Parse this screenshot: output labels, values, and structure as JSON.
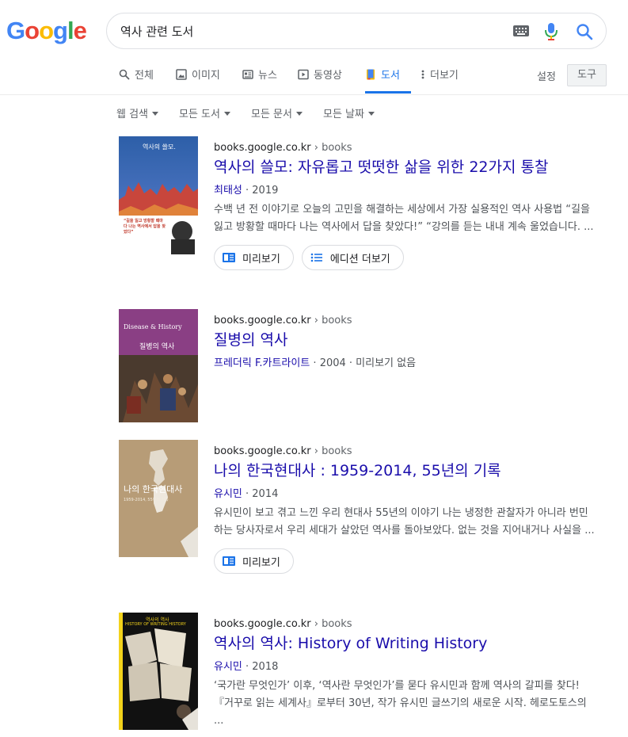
{
  "logo": {
    "letters": [
      "G",
      "o",
      "o",
      "g",
      "l",
      "e"
    ],
    "colors": [
      "#4285f4",
      "#ea4335",
      "#fbbc05",
      "#4285f4",
      "#34a853",
      "#ea4335"
    ]
  },
  "search": {
    "query": "역사 관련 도서"
  },
  "tabs": [
    {
      "label": "전체",
      "icon": "search-icon"
    },
    {
      "label": "이미지",
      "icon": "image-icon"
    },
    {
      "label": "뉴스",
      "icon": "news-icon"
    },
    {
      "label": "동영상",
      "icon": "video-icon"
    },
    {
      "label": "도서",
      "icon": "book-icon",
      "active": true
    },
    {
      "label": "더보기",
      "icon": "more-vert-icon"
    }
  ],
  "settings_label": "설정",
  "tools_label": "도구",
  "filters": [
    "웹 검색",
    "모든 도서",
    "모든 문서",
    "모든 날짜"
  ],
  "results": [
    {
      "domain": "books.google.co.kr",
      "crumb": "› books",
      "title": "역사의 쓸모: 자유롭고 떳떳한 삶을 위한 22가지 통찰",
      "author": "최태성",
      "meta_rest": " · 2019",
      "snippet": "수백 년 전 이야기로 오늘의 고민을 해결하는 세상에서 가장 실용적인 역사 사용법 “길을 잃고 방황할 때마다 나는 역사에서 답을 찾았다!” “강의를 듣는 내내 계속 울었습니다. ...",
      "chips": [
        "미리보기",
        "에디션 더보기"
      ],
      "cover": {
        "line1": "역사의 쓸모.",
        "quote": "“길을 잃고 방황할 때마다 나는 역사에서 답을 찾았다”"
      }
    },
    {
      "domain": "books.google.co.kr",
      "crumb": "› books",
      "title": "질병의 역사",
      "author": "프레더릭 F.카트라이트",
      "meta_rest": " · 2004 · 미리보기 없음",
      "snippet": "",
      "chips": [],
      "cover": {
        "line1": "Disease & History",
        "line2": "질병의 역사"
      }
    },
    {
      "domain": "books.google.co.kr",
      "crumb": "› books",
      "title": "나의 한국현대사 : 1959-2014, 55년의 기록",
      "author": "유시민",
      "meta_rest": " · 2014",
      "snippet": "유시민이 보고 겪고 느낀 우리 현대사 55년의 이야기 나는 냉정한 관찰자가 아니라 번민하는 당사자로서 우리 세대가 살았던 역사를 돌아보았다. 없는 것을 지어내거나 사실을 ...",
      "chips": [
        "미리보기"
      ],
      "cover": {
        "line1": "나의 한국현대사",
        "line2": "1959-2014, 55년의 기록"
      }
    },
    {
      "domain": "books.google.co.kr",
      "crumb": "› books",
      "title": "역사의 역사: History of Writing History",
      "author": "유시민",
      "meta_rest": " · 2018",
      "snippet": "‘국가란 무엇인가’ 이후, ‘역사란 무엇인가’를 묻다 유시민과 함께 역사의 갈피를 찾다! 『거꾸로 읽는 세계사』로부터 30년, 작가 유시민 글쓰기의 새로운 시작. 헤로도토스의 ...",
      "chips": [],
      "cover": {
        "line1": "역사의 역사",
        "line2": "HISTORY OF WRITING HISTORY"
      }
    }
  ]
}
